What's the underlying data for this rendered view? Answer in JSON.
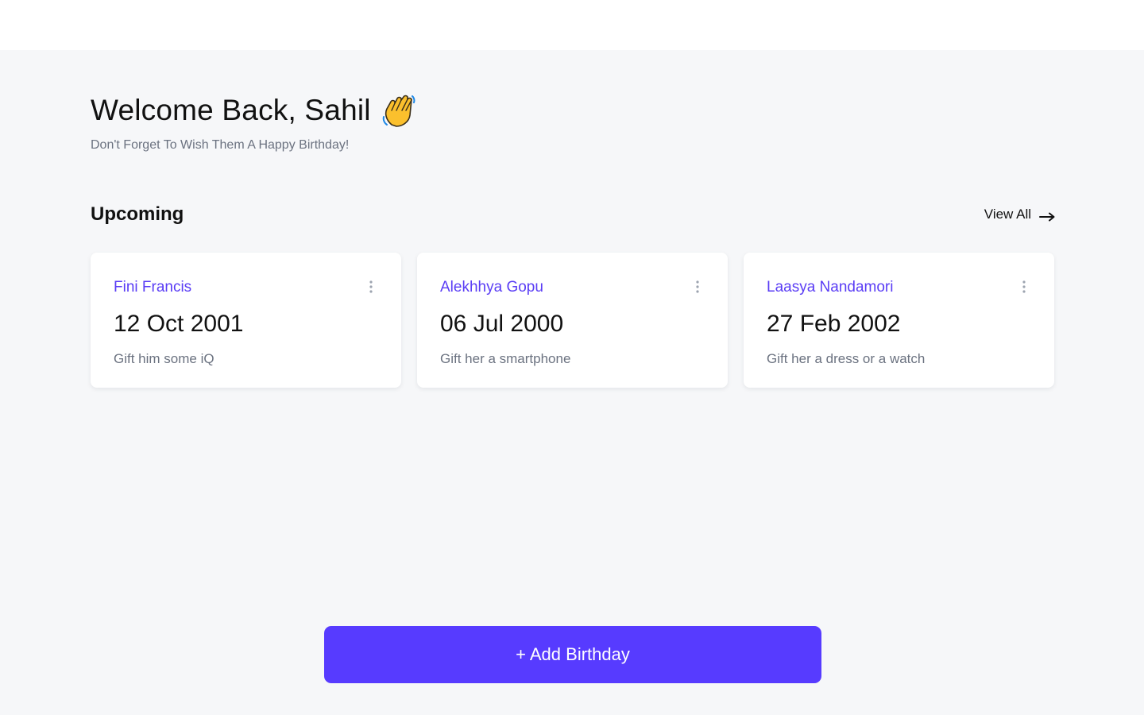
{
  "header": {
    "greeting": "Welcome Back, Sahil",
    "greeting_icon": "waving-hand-icon",
    "subtitle": "Don't Forget To Wish Them A Happy Birthday!"
  },
  "upcoming": {
    "title": "Upcoming",
    "view_all_label": "View All",
    "view_all_icon": "arrow-right-icon",
    "cards": [
      {
        "name": "Fini Francis",
        "date": "12 Oct 2001",
        "note": "Gift him some iQ",
        "menu_icon": "more-vertical-icon"
      },
      {
        "name": "Alekhhya Gopu",
        "date": "06 Jul 2000",
        "note": "Gift her a smartphone",
        "menu_icon": "more-vertical-icon"
      },
      {
        "name": "Laasya Nandamori",
        "date": "27 Feb 2002",
        "note": "Gift her a dress or a watch",
        "menu_icon": "more-vertical-icon"
      }
    ]
  },
  "actions": {
    "add_birthday_label": "+ Add Birthday"
  },
  "colors": {
    "accent": "#573bff",
    "name_text": "#5a3df5",
    "background": "#f6f7f9",
    "card": "#ffffff",
    "muted_text": "#6b7280"
  }
}
